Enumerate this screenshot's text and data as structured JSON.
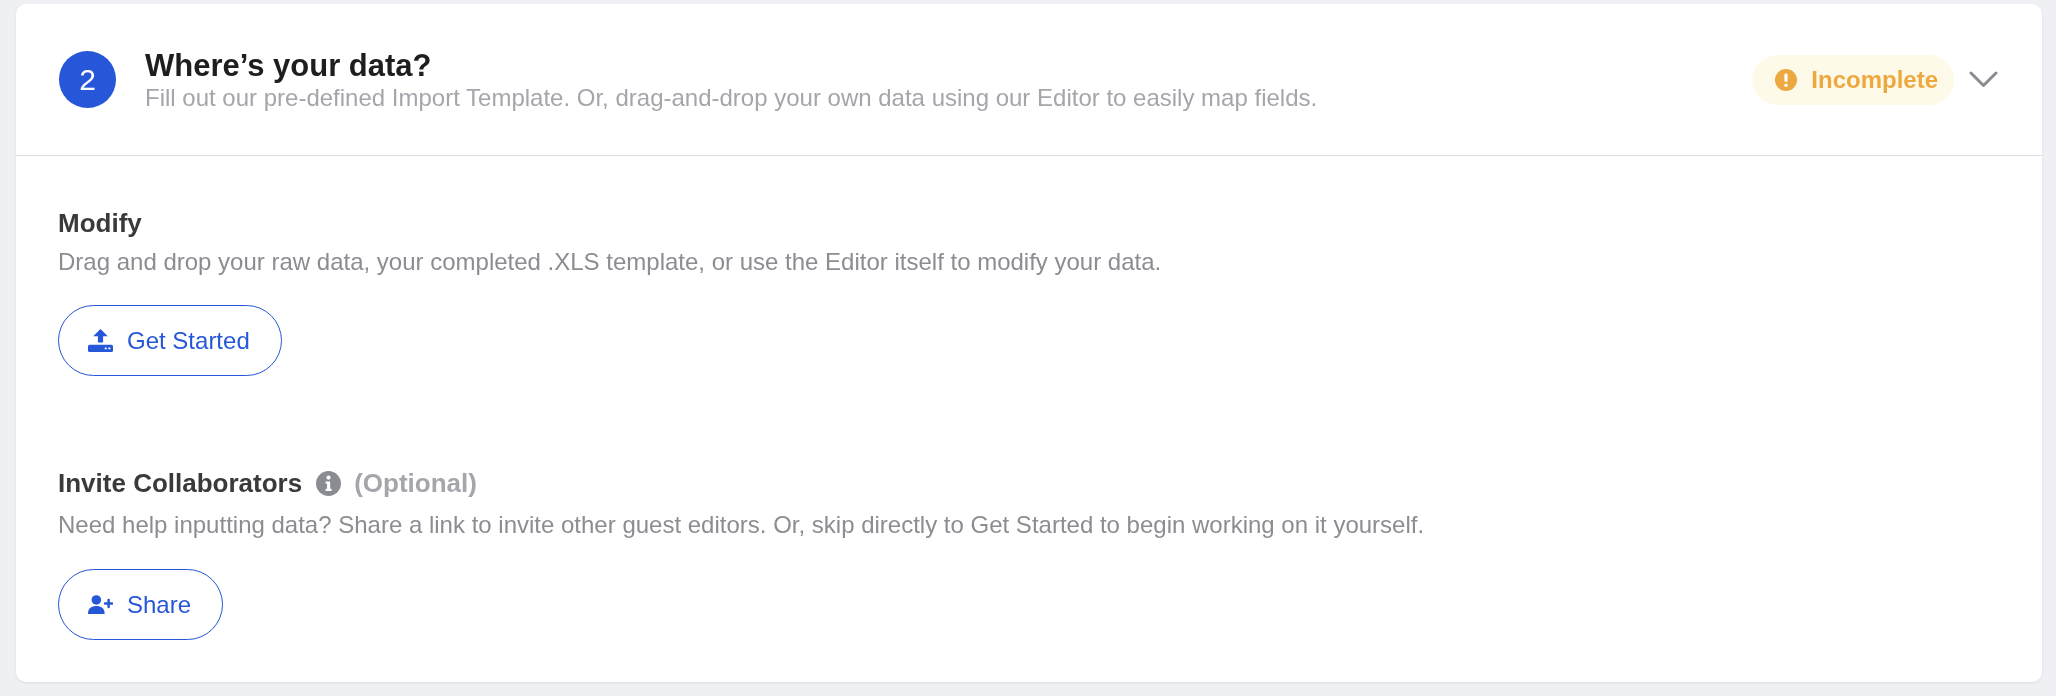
{
  "step": {
    "number": "2",
    "title": "Where’s your data?",
    "subtitle": "Fill out our pre-defined Import Template. Or, drag-and-drop your own data using our Editor to easily map fields.",
    "status": {
      "kind": "incomplete",
      "label": "Incomplete"
    }
  },
  "sections": [
    {
      "kind": "upload",
      "title": "Modify",
      "description": "Drag and drop your raw data, your completed .XLS template, or use the Editor itself to modify your data.",
      "button": "Get Started"
    },
    {
      "kind": "invite",
      "title": "Invite Collaborators",
      "note": "(Optional)",
      "description": "Need help inputting data? Share a link to invite other guest editors. Or, skip directly to Get Started to begin working on it yourself.",
      "button": "Share"
    }
  ]
}
